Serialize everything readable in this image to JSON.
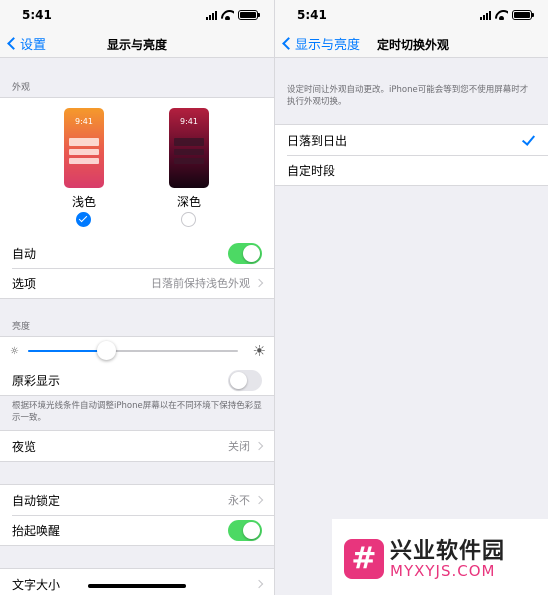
{
  "colors": {
    "accent": "#007aff",
    "toggle_on": "#4cd964",
    "brand_pink": "#e8357d"
  },
  "left": {
    "status": {
      "time": "5:41"
    },
    "nav": {
      "back_label": "设置",
      "title": "显示与亮度"
    },
    "appearance": {
      "section": "外观",
      "light": {
        "time": "9:41",
        "label": "浅色",
        "selected": true
      },
      "dark": {
        "time": "9:41",
        "label": "深色",
        "selected": false
      }
    },
    "automatic": {
      "label": "自动",
      "on": true
    },
    "options": {
      "label": "选项",
      "value": "日落前保持浅色外观"
    },
    "brightness": {
      "section": "亮度",
      "level": 0.37
    },
    "true_tone": {
      "label": "原彩显示",
      "on": false
    },
    "true_tone_note": "根据环境光线条件自动调整iPhone屏幕以在不同环境下保持色彩显示一致。",
    "night_shift": {
      "label": "夜览",
      "value": "关闭"
    },
    "auto_lock": {
      "label": "自动锁定",
      "value": "永不"
    },
    "raise_to_wake": {
      "label": "抬起唤醒",
      "on": true
    },
    "text_size": {
      "label": "文字大小"
    }
  },
  "right": {
    "status": {
      "time": "5:41"
    },
    "nav": {
      "back_label": "显示与亮度",
      "title": "定时切换外观"
    },
    "description": "设定时间让外观自动更改。iPhone可能会等到您不使用屏幕时才执行外观切换。",
    "options": [
      {
        "label": "日落到日出",
        "checked": true
      },
      {
        "label": "自定时段",
        "checked": false
      }
    ]
  },
  "watermark": {
    "logo_glyph": "#",
    "name": "兴业软件园",
    "url": "MYXYJS.COM"
  }
}
